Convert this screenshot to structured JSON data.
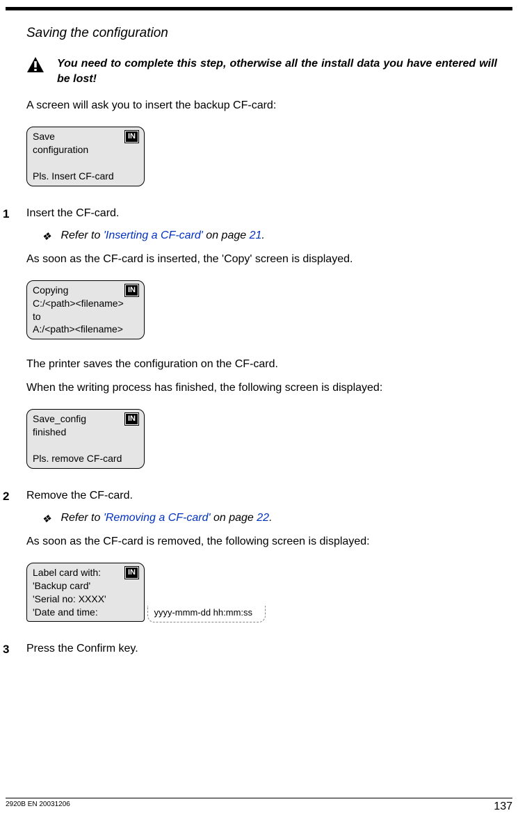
{
  "sectionTitle": "Saving the configuration",
  "warning": "You need to complete this step, otherwise all the install data you have entered will be lost!",
  "intro": "A screen will ask you to insert the backup CF-card:",
  "badge": "IN",
  "screen1": {
    "line1": "Save",
    "line2": "configuration",
    "line3": "",
    "line4": "Pls. Insert CF-card"
  },
  "step1": {
    "num": "1",
    "text": "Insert the CF-card."
  },
  "refer1": {
    "prefix": "Refer to ",
    "link": "'Inserting a CF-card'",
    "middle": " on page ",
    "page": "21",
    "suffix": "."
  },
  "afterInsert": "As soon as the CF-card is inserted, the 'Copy' screen is displayed.",
  "screen2": {
    "line1": "Copying",
    "line2": "C:/<path><filename>",
    "line3": "to",
    "line4": "A:/<path><filename>"
  },
  "printerSaves": "The printer saves the configuration on the CF-card.",
  "whenFinished": "When the writing process has finished, the following screen is displayed:",
  "screen3": {
    "line1": "Save_config",
    "line2": "finished",
    "line3": "",
    "line4": "Pls. remove CF-card"
  },
  "step2": {
    "num": "2",
    "text": "Remove the CF-card."
  },
  "refer2": {
    "prefix": "Refer to ",
    "link": "'Removing a CF-card'",
    "middle": " on page ",
    "page": "22",
    "suffix": "."
  },
  "afterRemove": "As soon as the CF-card is removed, the following screen is displayed:",
  "screen4": {
    "line1": "Label card with:",
    "line2": "'Backup card'",
    "line3": "'Serial no: XXXX'",
    "line4": "'Date and time:",
    "ext": "yyyy-mmm-dd hh:mm:ss"
  },
  "step3": {
    "num": "3",
    "text": "Press the Confirm key."
  },
  "footer": {
    "doc": "2920B EN 20031206",
    "page": "137"
  }
}
